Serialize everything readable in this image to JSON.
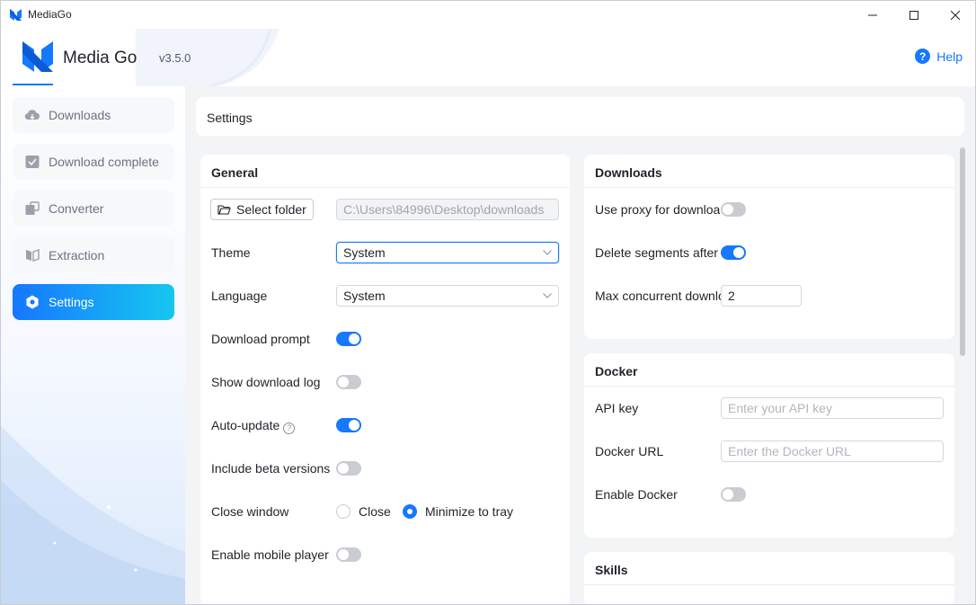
{
  "window": {
    "title": "MediaGo"
  },
  "brand": {
    "name": "Media Go",
    "version": "v3.5.0"
  },
  "header": {
    "help_label": "Help"
  },
  "sidebar": {
    "items": [
      {
        "label": "Downloads",
        "icon": "cloud-download-icon",
        "active": false
      },
      {
        "label": "Download complete",
        "icon": "check-box-icon",
        "active": false
      },
      {
        "label": "Converter",
        "icon": "convert-icon",
        "active": false
      },
      {
        "label": "Extraction",
        "icon": "extraction-icon",
        "active": false
      },
      {
        "label": "Settings",
        "icon": "settings-hexagon-icon",
        "active": true
      }
    ]
  },
  "page": {
    "breadcrumb": "Settings"
  },
  "general": {
    "title": "General",
    "select_folder_label": "Select folder",
    "folder_path": "C:\\Users\\84996\\Desktop\\downloads",
    "theme_label": "Theme",
    "theme_value": "System",
    "language_label": "Language",
    "language_value": "System",
    "download_prompt_label": "Download prompt",
    "download_prompt_on": true,
    "show_log_label": "Show download log",
    "show_log_on": false,
    "auto_update_label": "Auto-update",
    "auto_update_on": true,
    "beta_label": "Include beta versions",
    "beta_on": false,
    "close_window_label": "Close window",
    "close_option": "Close",
    "minimize_option": "Minimize to tray",
    "close_window_value": "Minimize to tray",
    "mobile_player_label": "Enable mobile player",
    "mobile_player_on": false
  },
  "downloads": {
    "title": "Downloads",
    "proxy_label": "Use proxy for downloa",
    "proxy_on": false,
    "delete_segments_label": "Delete segments after",
    "delete_segments_on": true,
    "max_concurrent_label": "Max concurrent downlo",
    "max_concurrent_value": "2"
  },
  "docker": {
    "title": "Docker",
    "api_key_label": "API key",
    "api_key_placeholder": "Enter your API key",
    "url_label": "Docker URL",
    "url_placeholder": "Enter the Docker URL",
    "enable_label": "Enable Docker",
    "enable_on": false
  },
  "skills": {
    "title": "Skills"
  },
  "colors": {
    "accent": "#1677ff",
    "accent_gradient_end": "#16c6f0",
    "switch_off": "#c9ccd1"
  }
}
